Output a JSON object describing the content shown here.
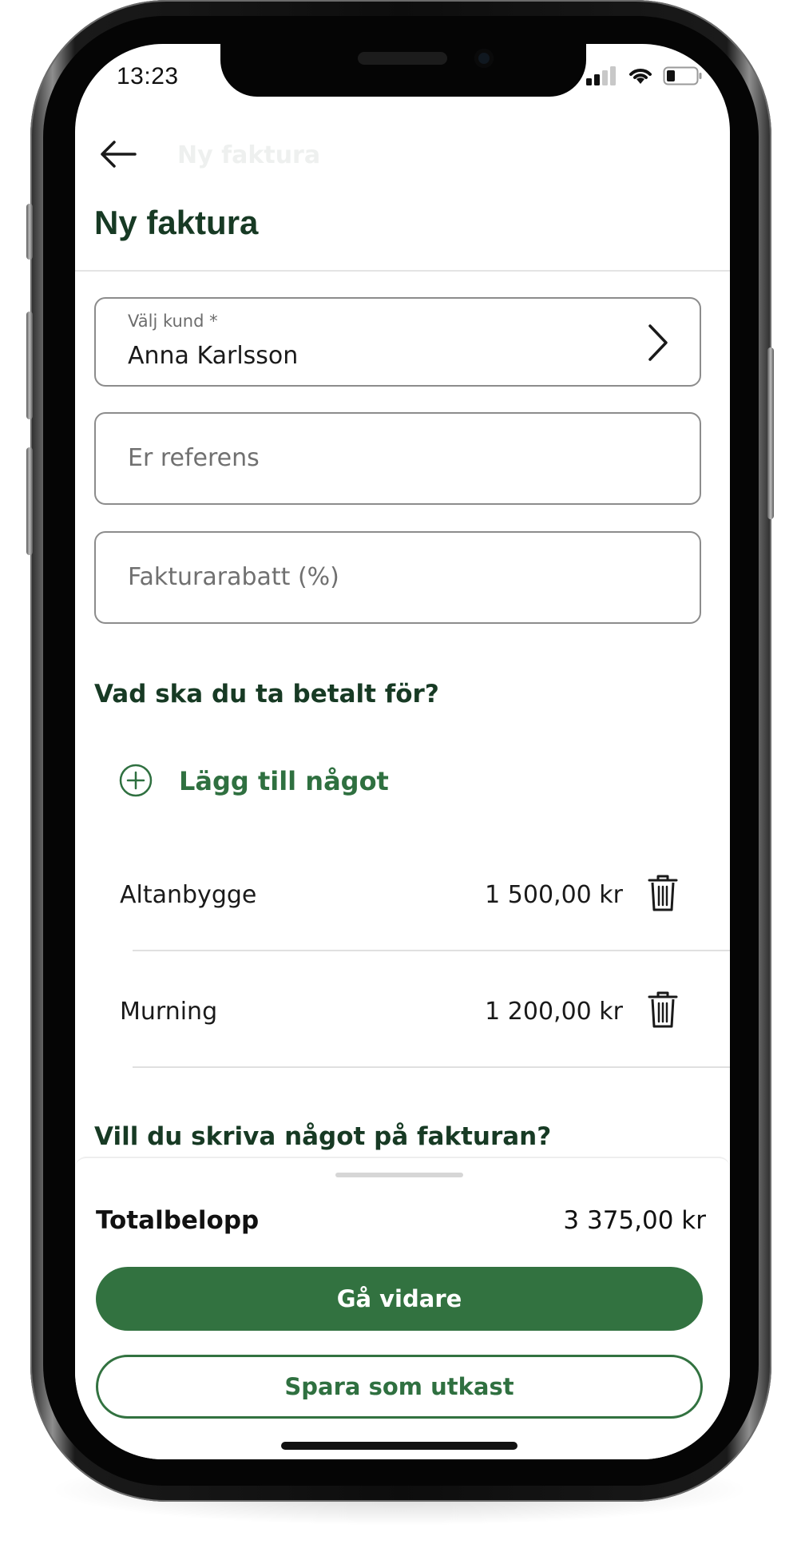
{
  "status_bar": {
    "time": "13:23",
    "icons": [
      "cellular-signal-icon",
      "wifi-icon",
      "battery-icon"
    ]
  },
  "header": {
    "back_icon": "arrow-left-icon",
    "faint_title": "Ny faktura",
    "title": "Ny faktura"
  },
  "form": {
    "customer": {
      "label": "Välj kund *",
      "value": "Anna Karlsson",
      "icon": "chevron-right-icon"
    },
    "reference": {
      "placeholder": "Er referens",
      "value": ""
    },
    "discount": {
      "placeholder": "Fakturarabatt (%)",
      "value": ""
    }
  },
  "items_section": {
    "heading": "Vad ska du ta betalt för?",
    "add_label": "Lägg till något",
    "add_icon": "plus-circle-icon",
    "items": [
      {
        "name": "Altanbygge",
        "price": "1 500,00 kr",
        "icon": "trash-icon"
      },
      {
        "name": "Murning",
        "price": "1 200,00 kr",
        "icon": "trash-icon"
      }
    ]
  },
  "notes_section": {
    "heading": "Vill du skriva något på fakturan?"
  },
  "summary": {
    "total_label": "Totalbelopp",
    "total_value": "3 375,00 kr",
    "primary_button": "Gå vidare",
    "secondary_button": "Spara som utkast"
  },
  "colors": {
    "brand_green": "#327240",
    "heading_green": "#173a24",
    "accent_green_text": "#2f7040"
  }
}
